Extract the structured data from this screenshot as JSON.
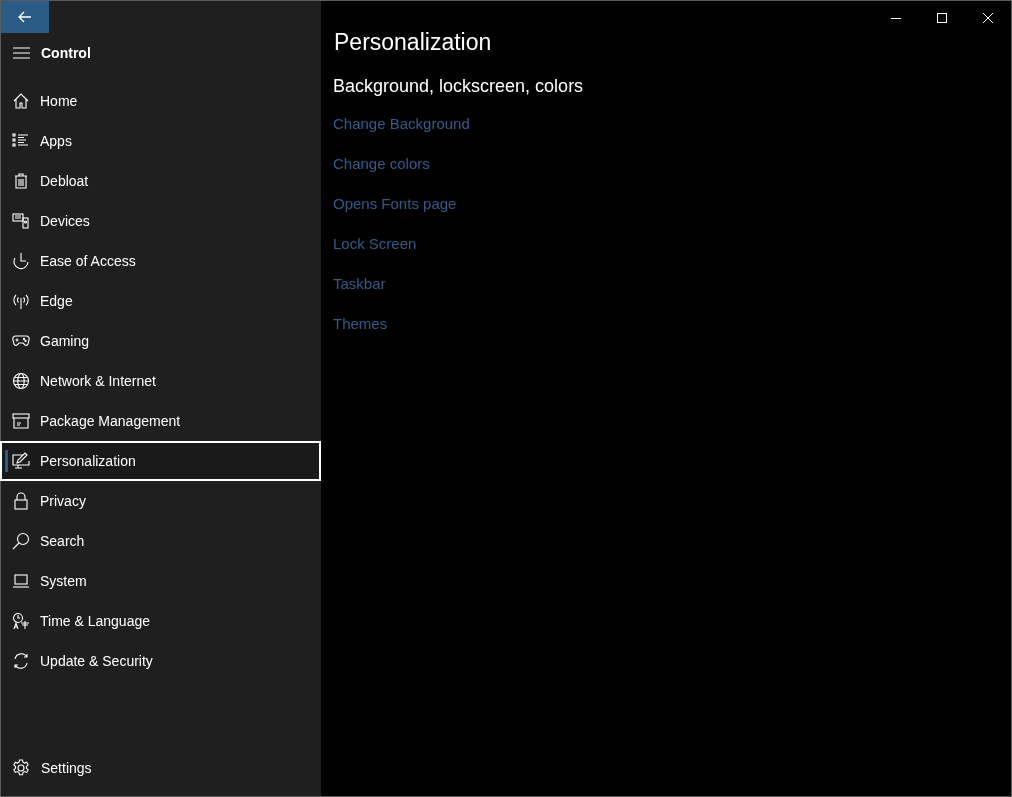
{
  "app": {
    "title": "Control"
  },
  "nav_items": [
    {
      "label": "Home",
      "selected": false
    },
    {
      "label": "Apps",
      "selected": false
    },
    {
      "label": "Debloat",
      "selected": false
    },
    {
      "label": "Devices",
      "selected": false
    },
    {
      "label": "Ease of Access",
      "selected": false
    },
    {
      "label": "Edge",
      "selected": false
    },
    {
      "label": "Gaming",
      "selected": false
    },
    {
      "label": "Network & Internet",
      "selected": false
    },
    {
      "label": "Package Management",
      "selected": false
    },
    {
      "label": "Personalization",
      "selected": true
    },
    {
      "label": "Privacy",
      "selected": false
    },
    {
      "label": "Search",
      "selected": false
    },
    {
      "label": "System",
      "selected": false
    },
    {
      "label": "Time & Language",
      "selected": false
    },
    {
      "label": "Update & Security",
      "selected": false
    }
  ],
  "footer_item": {
    "label": "Settings"
  },
  "page": {
    "title": "Personalization",
    "section_title": "Background, lockscreen, colors",
    "links": [
      "Change Background",
      "Change colors",
      "Opens Fonts page",
      "Lock Screen",
      "Taskbar",
      "Themes"
    ]
  }
}
